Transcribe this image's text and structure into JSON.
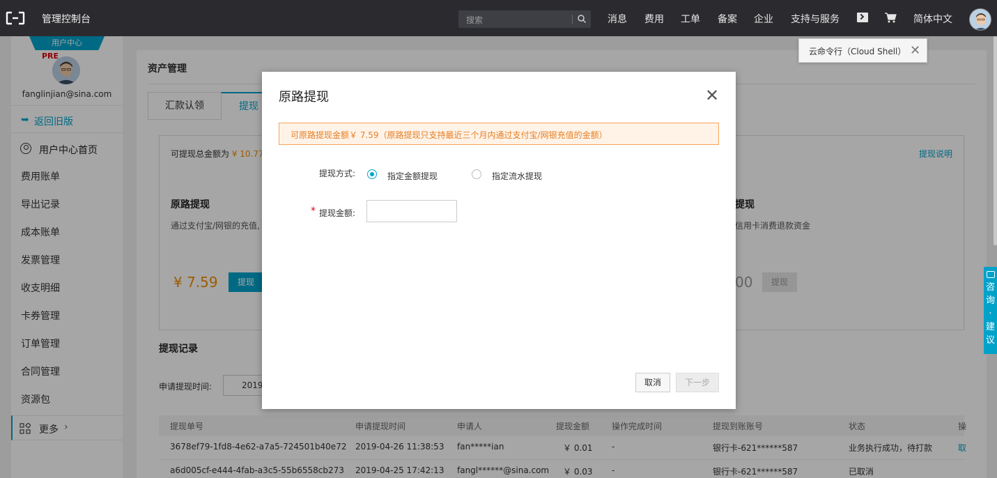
{
  "topbar": {
    "title": "管理控制台",
    "search_placeholder": "搜索",
    "nav": [
      "消息",
      "费用",
      "工单",
      "备案",
      "企业",
      "支持与服务"
    ],
    "language": "简体中文"
  },
  "tooltip": {
    "text": "云命令行（Cloud Shell）"
  },
  "sidebar": {
    "badge": "用户中心",
    "pre": "PRE",
    "email": "fanglinjian@sina.com",
    "back": "返回旧版",
    "home": "用户中心首页",
    "items": [
      "费用账单",
      "导出记录",
      "成本账单",
      "发票管理",
      "收支明细",
      "卡券管理",
      "订单管理",
      "合同管理",
      "资源包"
    ],
    "more": "更多"
  },
  "main": {
    "title": "资产管理",
    "tabs": [
      "汇款认领",
      "提现"
    ],
    "summary_label": "可提现总金额为",
    "summary_amount": "¥ 10.77",
    "help_link": "提现说明",
    "card1": {
      "title": "原路提现",
      "desc": "通过支付宝/网银的充值,",
      "amount": "¥ 7.59",
      "button": "提现"
    },
    "card2": {
      "title": "提现",
      "desc": "信用卡消费退款资金",
      "amount": "00",
      "button": "提现"
    },
    "records_title": "提现记录",
    "date_label": "申请提现时间:",
    "date_value": "2019",
    "table": {
      "headers": [
        "提现单号",
        "申请提现时间",
        "申请人",
        "提现金额",
        "操作完成时间",
        "提现到账账号",
        "状态",
        "操"
      ],
      "rows": [
        [
          "3678ef79-1fd8-4e62-a7a5-724501b40e72",
          "2019-04-26 11:38:53",
          "fan*****ian",
          "￥ 0.01",
          "-",
          "银行卡-621******587",
          "业务执行成功，待打款",
          "取"
        ],
        [
          "a6d005cf-e444-4fab-a3c5-55b6558cb273",
          "2019-04-25 17:42:13",
          "fangl******@sina.com",
          "￥ 0.03",
          "-",
          "银行卡-621******587",
          "已取消",
          ""
        ]
      ]
    }
  },
  "modal": {
    "title": "原路提现",
    "alert": "可原路提现金额￥ 7.59（原路提现只支持最近三个月内通过支付宝/网银充值的金额）",
    "method_label": "提现方式:",
    "option1": "指定金额提现",
    "option2": "指定流水提现",
    "selected_option": "指定金额提现",
    "required_mark": "*",
    "amount_label": "提现金额:",
    "amount_value": "",
    "cancel": "取消",
    "next": "下一步"
  },
  "consult": {
    "text": "咨询·建议"
  },
  "colors": {
    "accent": "#00a2ca",
    "warning": "#f28c00",
    "topbar": "#2b2b2f"
  }
}
